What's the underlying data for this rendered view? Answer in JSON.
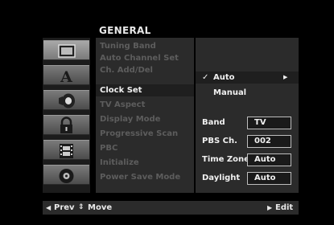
{
  "header": {
    "title": "GENERAL"
  },
  "icon_tabs": [
    {
      "icon": "tv-screen-icon"
    },
    {
      "icon": "language-a-icon"
    },
    {
      "icon": "speaker-audio-icon"
    },
    {
      "icon": "padlock-icon"
    },
    {
      "icon": "film-icon"
    },
    {
      "icon": "disc-icon"
    }
  ],
  "menu": {
    "items": [
      {
        "label": "Tuning Band"
      },
      {
        "label": "Auto Channel Set"
      },
      {
        "label": "Ch. Add/Del"
      },
      {
        "label": "Clock Set"
      },
      {
        "label": "TV Aspect"
      },
      {
        "label": "Display Mode"
      },
      {
        "label": "Progressive Scan"
      },
      {
        "label": "PBC"
      },
      {
        "label": "Initialize"
      },
      {
        "label": "Power Save Mode"
      }
    ],
    "selected_index": 3
  },
  "options": {
    "auto": "Auto",
    "manual": "Manual"
  },
  "settings": {
    "band": {
      "label": "Band",
      "value": "TV"
    },
    "pbs": {
      "label": "PBS Ch.",
      "value": "002"
    },
    "timezone": {
      "label": "Time Zone",
      "value": "Auto"
    },
    "daylight": {
      "label": "Daylight",
      "value": "Auto"
    }
  },
  "footer": {
    "prev": "Prev",
    "move": "Move",
    "edit": "Edit"
  },
  "colors": {
    "background": "#000000",
    "panel": "#2b2b2b",
    "text_active": "#f0f0f0",
    "text_inactive": "#5d5d5d"
  }
}
